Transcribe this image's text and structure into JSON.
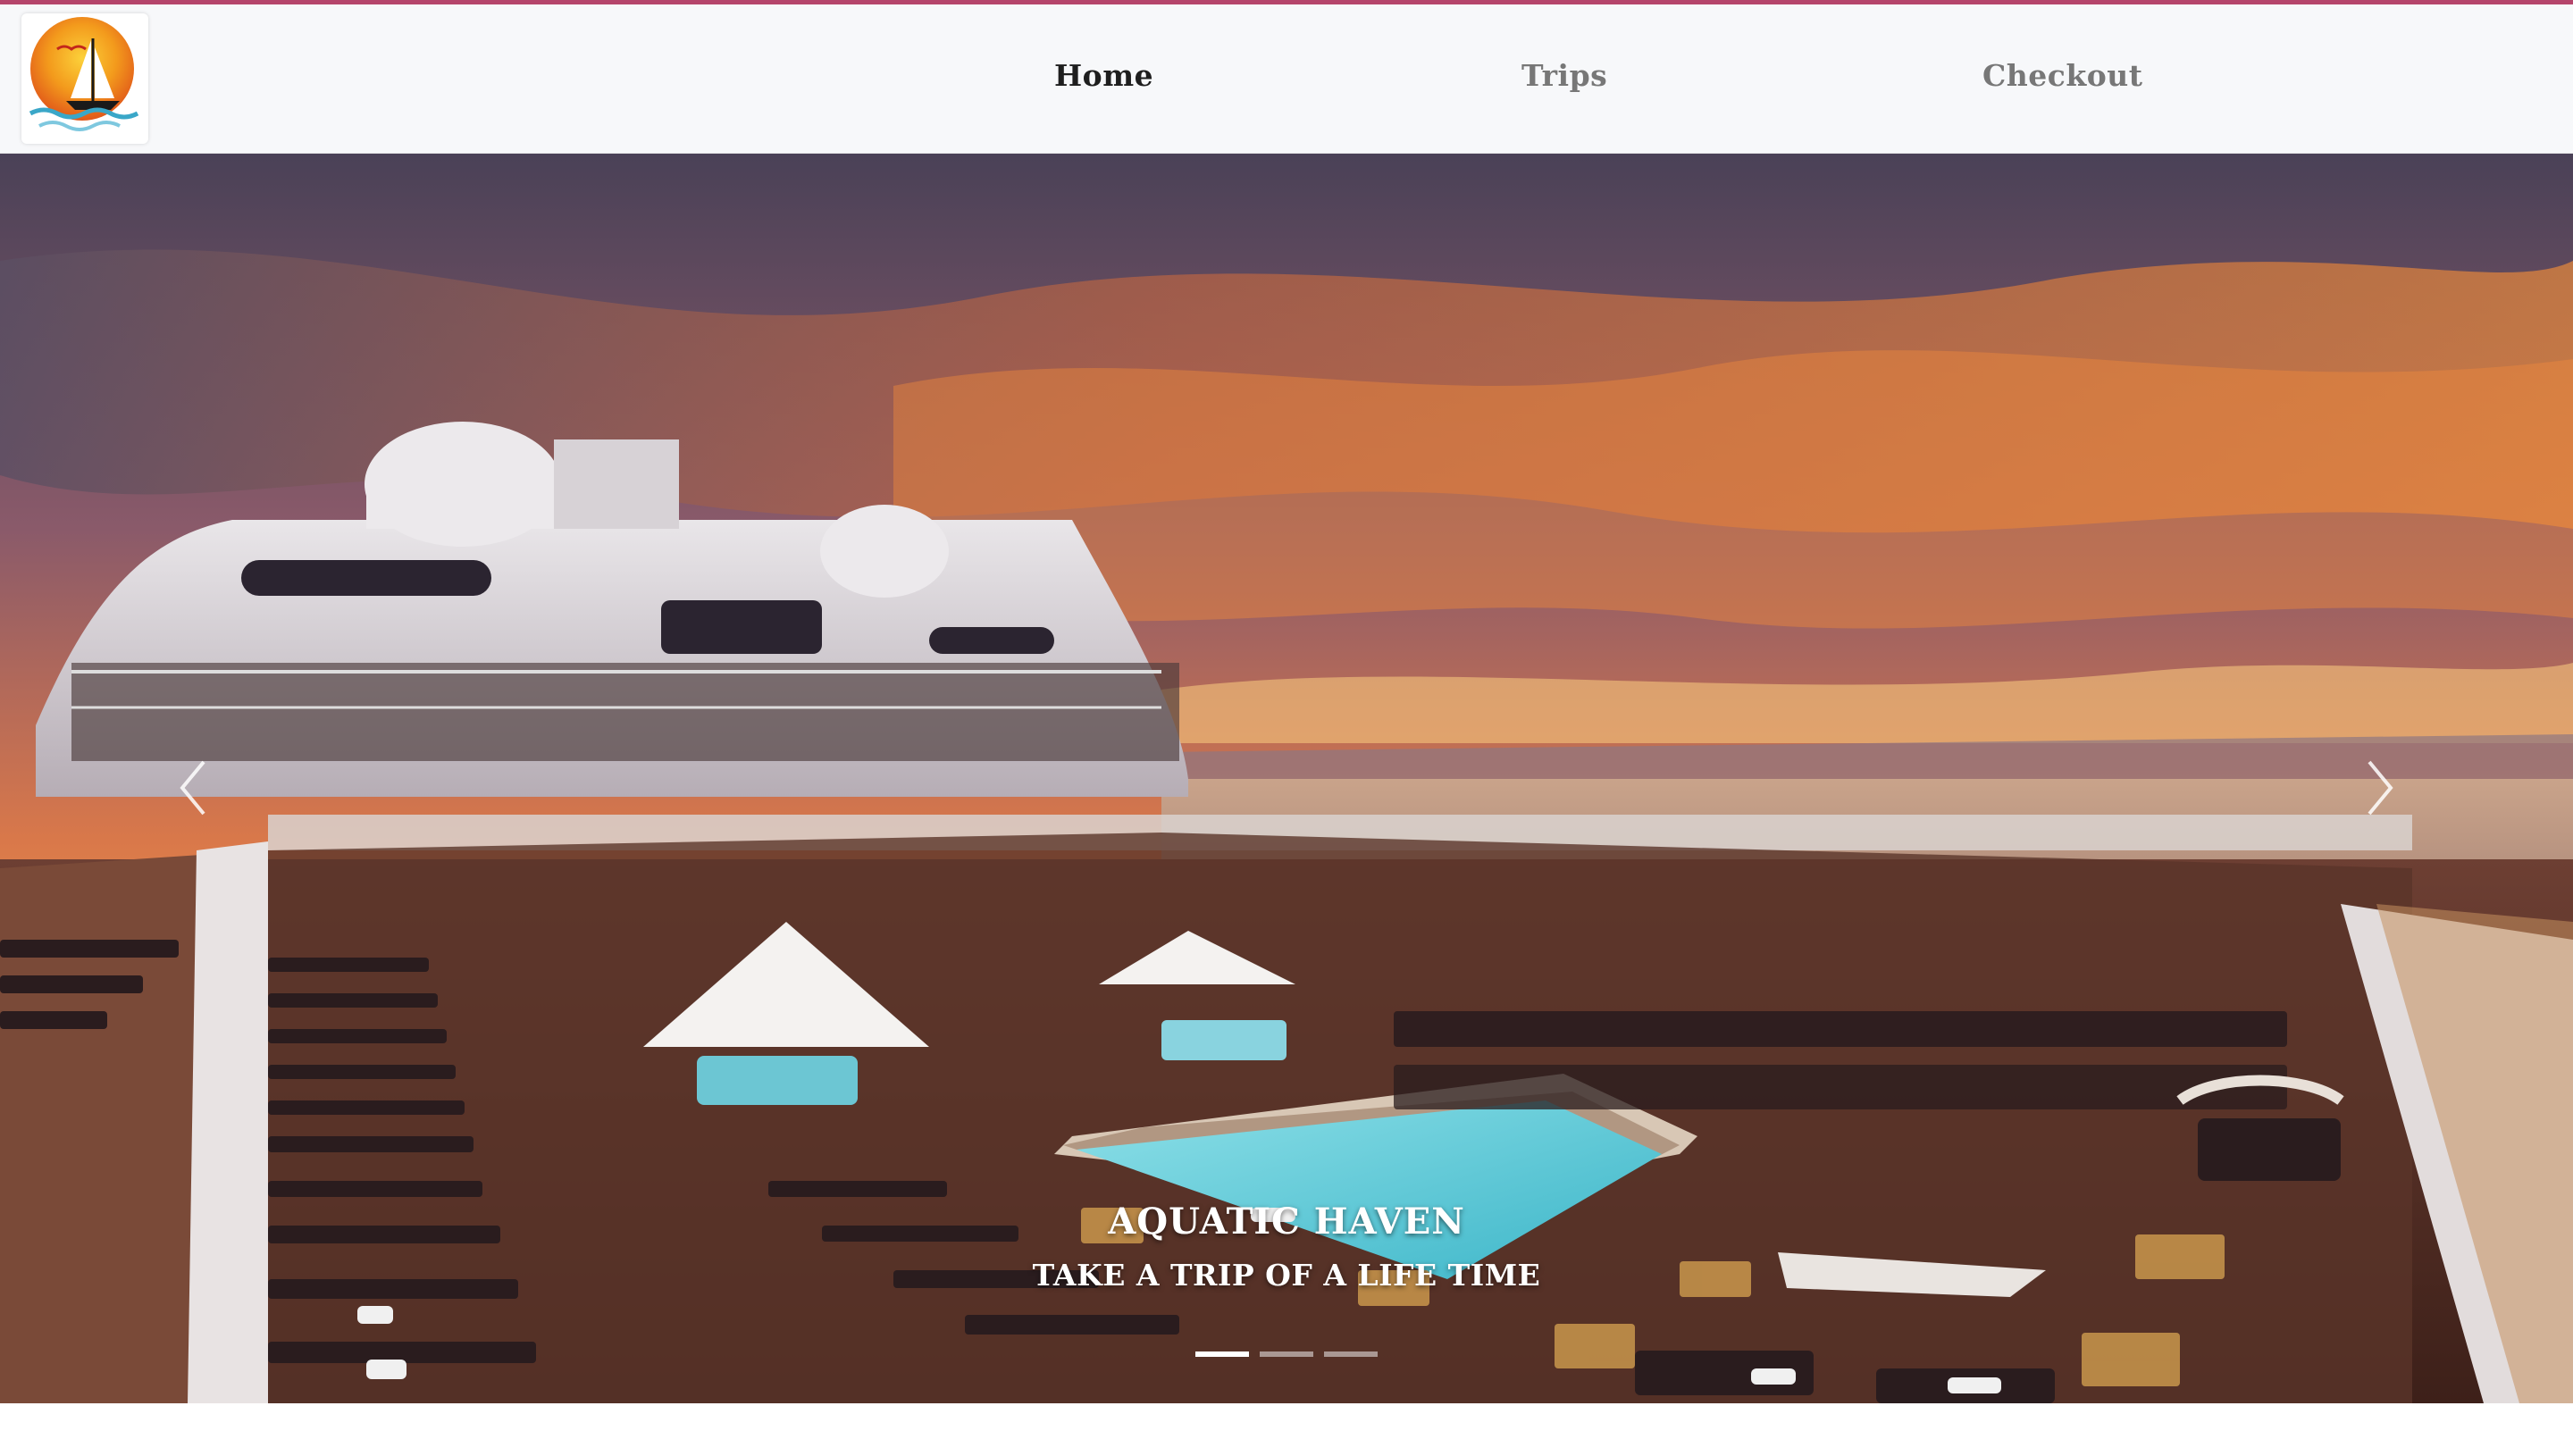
{
  "nav": {
    "logo_alt": "Aquatic Haven logo",
    "links": [
      "Home",
      "Trips",
      "Checkout"
    ],
    "active": "Home"
  },
  "carousel": {
    "caption_title": "AQUATIC HAVEN",
    "caption_subtitle": "TAKE A TRIP OF A LIFE TIME",
    "slide_count": 3,
    "active_index": 0,
    "prev_icon": "chevron-left-icon",
    "next_icon": "chevron-right-icon"
  },
  "colors": {
    "accent_line": "#b5456b",
    "nav_bg": "#f7f8fa",
    "active_link": "#1e1e1e",
    "inactive_link": "#777777"
  }
}
